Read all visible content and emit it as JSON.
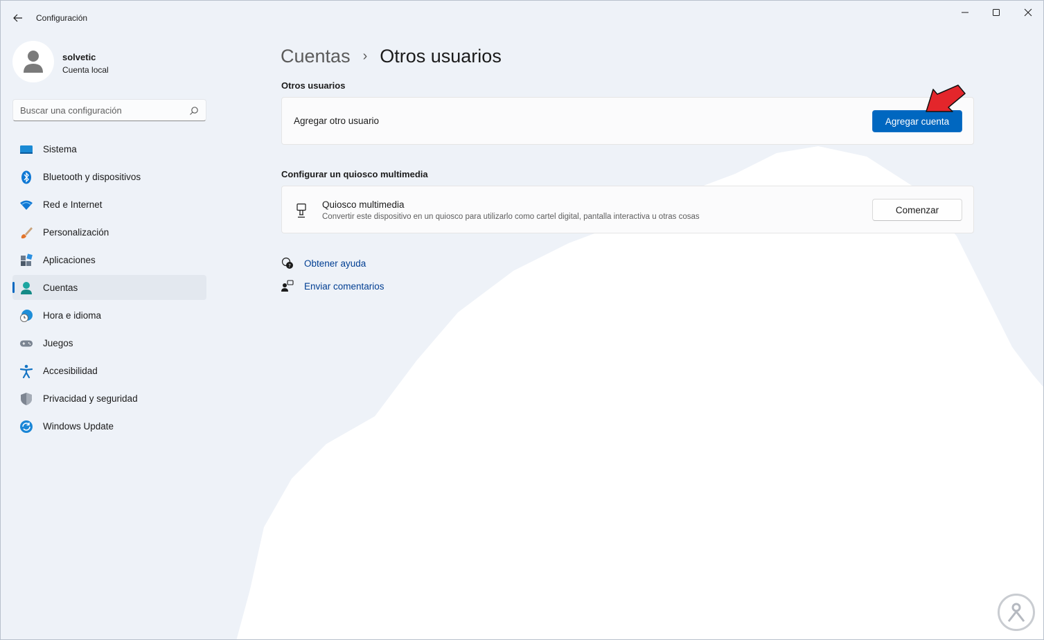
{
  "window": {
    "title": "Configuración",
    "controls": [
      "minimize-icon",
      "maximize-icon",
      "close-icon"
    ]
  },
  "profile": {
    "name": "solvetic",
    "account_type": "Cuenta local"
  },
  "search": {
    "placeholder": "Buscar una configuración"
  },
  "sidebar": {
    "items": [
      {
        "label": "Sistema",
        "icon": "system-icon"
      },
      {
        "label": "Bluetooth y dispositivos",
        "icon": "bluetooth-icon"
      },
      {
        "label": "Red e Internet",
        "icon": "wifi-icon"
      },
      {
        "label": "Personalización",
        "icon": "brush-icon"
      },
      {
        "label": "Aplicaciones",
        "icon": "apps-icon"
      },
      {
        "label": "Cuentas",
        "icon": "account-icon",
        "active": true
      },
      {
        "label": "Hora e idioma",
        "icon": "globe-clock-icon"
      },
      {
        "label": "Juegos",
        "icon": "gamepad-icon"
      },
      {
        "label": "Accesibilidad",
        "icon": "accessibility-icon"
      },
      {
        "label": "Privacidad y seguridad",
        "icon": "shield-icon"
      },
      {
        "label": "Windows Update",
        "icon": "update-icon"
      }
    ]
  },
  "breadcrumb": {
    "parent": "Cuentas",
    "separator": "›",
    "current": "Otros usuarios"
  },
  "other_users": {
    "section_title": "Otros usuarios",
    "row_label": "Agregar otro usuario",
    "button_label": "Agregar cuenta"
  },
  "kiosk": {
    "section_title": "Configurar un quiosco multimedia",
    "title": "Quiosco multimedia",
    "description": "Convertir este dispositivo en un quiosco para utilizarlo como cartel digital, pantalla interactiva u otras cosas",
    "button_label": "Comenzar"
  },
  "links": {
    "help": "Obtener ayuda",
    "feedback": "Enviar comentarios"
  },
  "colors": {
    "accent": "#0067c0",
    "annotation_arrow": "#e3262b"
  }
}
